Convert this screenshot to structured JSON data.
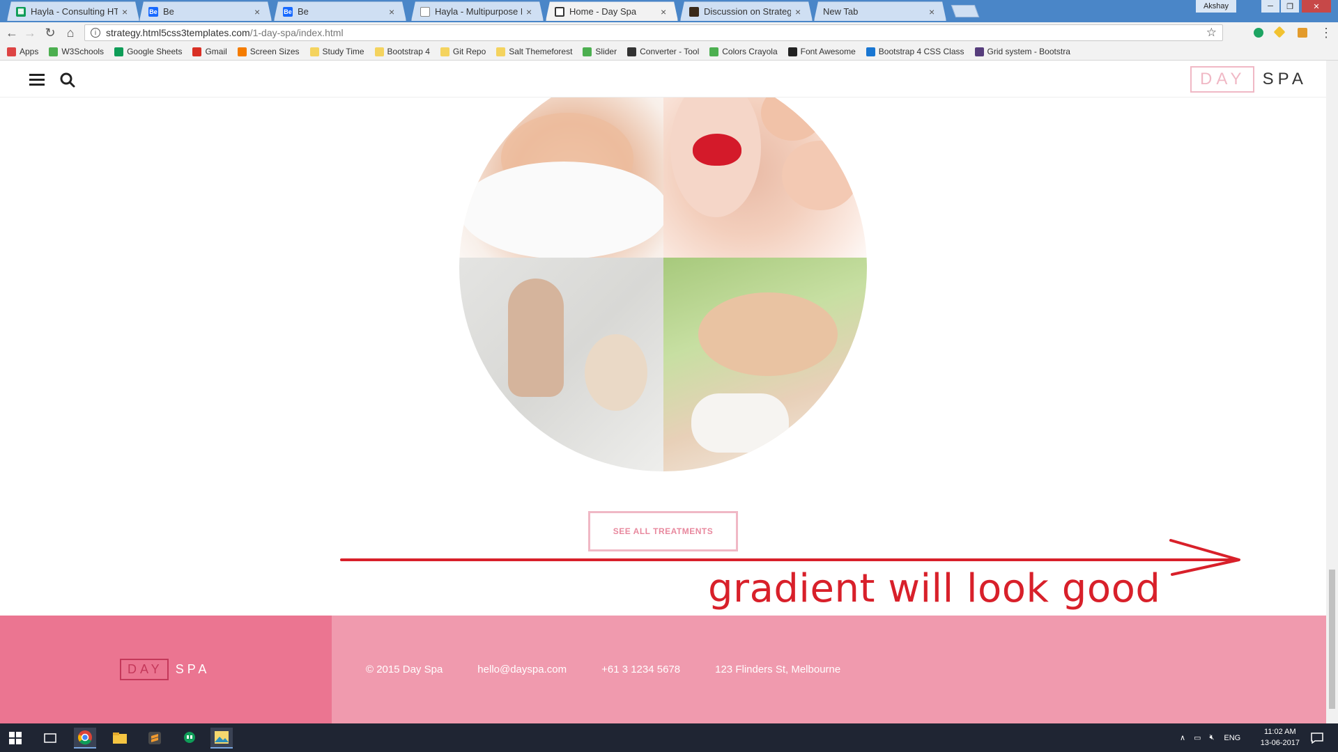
{
  "browser": {
    "tabs": [
      {
        "title": "Hayla - Consulting HTML",
        "active": false
      },
      {
        "title": "Be",
        "active": false
      },
      {
        "title": "Be",
        "active": false
      },
      {
        "title": "Hayla - Multipurpose Bu",
        "active": false
      },
      {
        "title": "Home - Day Spa",
        "active": true
      },
      {
        "title": "Discussion on Strategy M",
        "active": false
      },
      {
        "title": "New Tab",
        "active": false
      }
    ],
    "user_label": "Akshay",
    "url_host": "strategy.html5css3templates.com",
    "url_path": "/1-day-spa/index.html",
    "bookmarks": [
      {
        "label": "Apps",
        "icon": "apps-grid-icon",
        "color": "#d44"
      },
      {
        "label": "W3Schools",
        "icon": "w3schools-icon",
        "color": "#4caf50"
      },
      {
        "label": "Google Sheets",
        "icon": "sheets-icon",
        "color": "#0f9d58"
      },
      {
        "label": "Gmail",
        "icon": "gmail-icon",
        "color": "#d93025"
      },
      {
        "label": "Screen Sizes",
        "icon": "screen-sizes-icon",
        "color": "#f57c00"
      },
      {
        "label": "Study Time",
        "icon": "folder-icon",
        "color": "#f4d35e"
      },
      {
        "label": "Bootstrap 4",
        "icon": "folder-icon",
        "color": "#f4d35e"
      },
      {
        "label": "Git Repo",
        "icon": "folder-icon",
        "color": "#f4d35e"
      },
      {
        "label": "Salt Themeforest",
        "icon": "folder-icon",
        "color": "#f4d35e"
      },
      {
        "label": "Slider",
        "icon": "slider-icon",
        "color": "#4caf50"
      },
      {
        "label": "Converter - Tool",
        "icon": "converter-icon",
        "color": "#333"
      },
      {
        "label": "Colors Crayola",
        "icon": "crayola-icon",
        "color": "#4caf50"
      },
      {
        "label": "Font Awesome",
        "icon": "font-awesome-icon",
        "color": "#222"
      },
      {
        "label": "Bootstrap 4 CSS Class",
        "icon": "bootstrap-class-icon",
        "color": "#1976d2"
      },
      {
        "label": "Grid system - Bootstra",
        "icon": "bootstrap-icon",
        "color": "#563d7c"
      }
    ]
  },
  "site": {
    "logo_day": "DAY",
    "logo_spa": "SPA",
    "cta_label": "SEE ALL TREATMENTS",
    "footer": {
      "logo_day": "DAY",
      "logo_spa": "SPA",
      "copyright": "© 2015 Day Spa",
      "email": "hello@dayspa.com",
      "phone": "+61 3 1234 5678",
      "address": "123 Flinders St, Melbourne"
    },
    "colors": {
      "footer_left": "#eb7591",
      "footer_right": "#f09aae",
      "accent_pink": "#f0b8c5"
    }
  },
  "annotation": {
    "text": "gradient will look good",
    "color": "#d8202a"
  },
  "taskbar": {
    "lang": "ENG",
    "time": "11:02 AM",
    "date": "13-06-2017"
  }
}
